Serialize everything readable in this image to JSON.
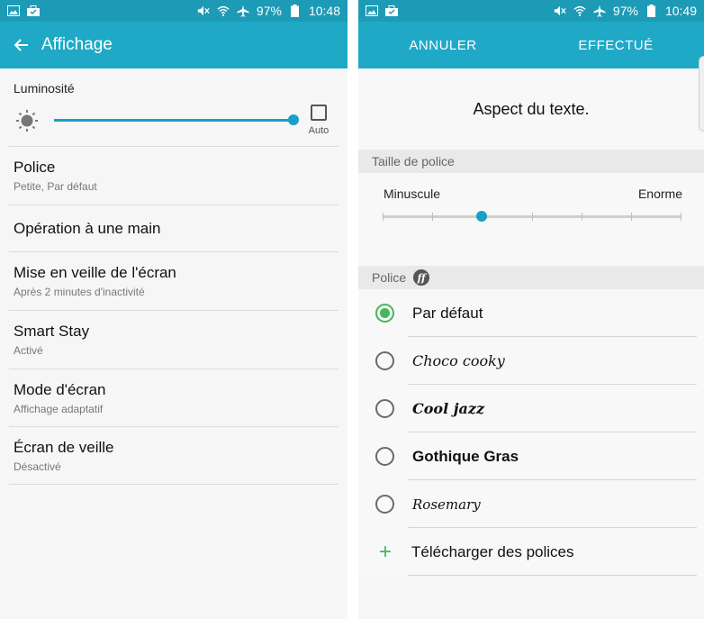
{
  "left": {
    "status": {
      "battery": "97%",
      "time": "10:48"
    },
    "appbar": {
      "title": "Affichage"
    },
    "brightness": {
      "label": "Luminosité",
      "level_percent": 100,
      "auto_label": "Auto",
      "auto_checked": false
    },
    "items": [
      {
        "title": "Police",
        "subtitle": "Petite, Par défaut"
      },
      {
        "title": "Opération à une main",
        "subtitle": ""
      },
      {
        "title": "Mise en veille de l'écran",
        "subtitle": "Après 2 minutes d'inactivité"
      },
      {
        "title": "Smart Stay",
        "subtitle": "Activé"
      },
      {
        "title": "Mode d'écran",
        "subtitle": "Affichage adaptatif"
      },
      {
        "title": "Écran de veille",
        "subtitle": "Désactivé"
      }
    ]
  },
  "right": {
    "status": {
      "battery": "97%",
      "time": "10:49"
    },
    "actions": {
      "cancel": "ANNULER",
      "done": "EFFECTUÉ"
    },
    "preview_text": "Aspect du texte.",
    "font_size": {
      "section_label": "Taille de police",
      "min_label": "Minuscule",
      "max_label": "Enorme",
      "steps": 7,
      "selected_step": 2
    },
    "font": {
      "section_label": "Police",
      "badge": "ff",
      "options": [
        {
          "name": "Par défaut",
          "selected": true
        },
        {
          "name": "Choco cooky",
          "selected": false
        },
        {
          "name": "Cool jazz",
          "selected": false
        },
        {
          "name": "Gothique Gras",
          "selected": false
        },
        {
          "name": "Rosemary",
          "selected": false
        }
      ],
      "download_label": "Télécharger des polices"
    }
  },
  "colors": {
    "appbar": "#1fa9c7",
    "statusbar": "#1d9bb6",
    "accent": "#19a0c5",
    "radio_on": "#43b75b"
  }
}
